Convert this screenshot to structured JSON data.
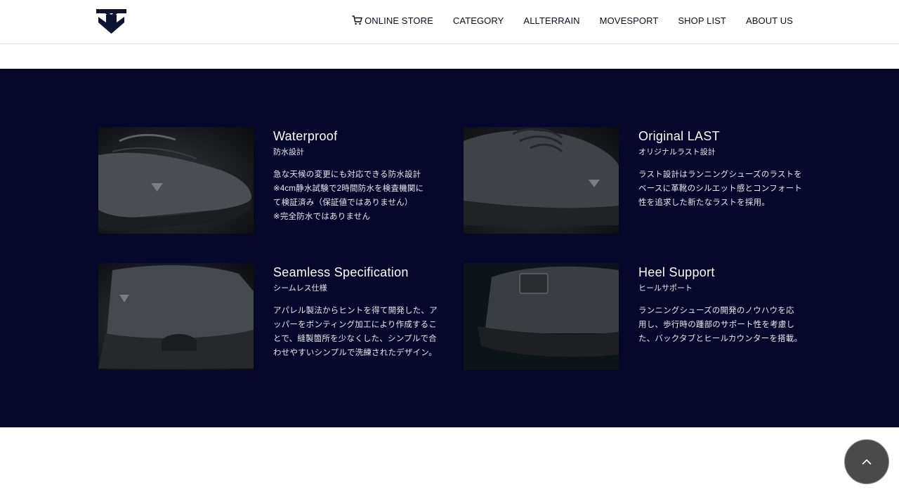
{
  "header": {
    "nav": [
      {
        "label": "ONLINE STORE",
        "icon": "cart-icon"
      },
      {
        "label": "CATEGORY"
      },
      {
        "label": "ALLTERRAIN"
      },
      {
        "label": "MOVESPORT"
      },
      {
        "label": "SHOP LIST"
      },
      {
        "label": "ABOUT US"
      }
    ]
  },
  "features": [
    {
      "title": "Waterproof",
      "subtitle": "防水設計",
      "lines": [
        "急な天候の変更にも対応できる防水設計",
        "※4cm静水試験で2時間防水を検査機関に",
        "て検証済み（保証値ではありません）",
        "※完全防水ではありません"
      ]
    },
    {
      "title": "Original LAST",
      "subtitle": "オリジナルラスト設計",
      "lines": [
        "ラスト設計はランニングシューズのラストを",
        "ベースに革靴のシルエット感とコンフォート",
        "性を追求した新たなラストを採用。"
      ]
    },
    {
      "title": "Seamless Specification",
      "subtitle": "シームレス仕様",
      "lines": [
        "アパレル製法からヒントを得て開発した、ア",
        "ッパーをボンティング加工により作成するこ",
        "とで、縫製箇所を少なくした、シンプルで合",
        "わせやすいシンプルで洗練されたデザイン。"
      ]
    },
    {
      "title": "Heel Support",
      "subtitle": "ヒールサポート",
      "lines": [
        "ランニングシューズの開発のノウハウを応",
        "用し、歩行時の踵部のサポート性を考慮し",
        "た、バックタブとヒールカウンターを搭載。"
      ]
    }
  ],
  "colors": {
    "section_bg": "#05082a",
    "logo": "#0d1330",
    "back_to_top_bg": "#4a4a4a"
  },
  "icons": {
    "back_to_top": "chevron-up-icon"
  }
}
